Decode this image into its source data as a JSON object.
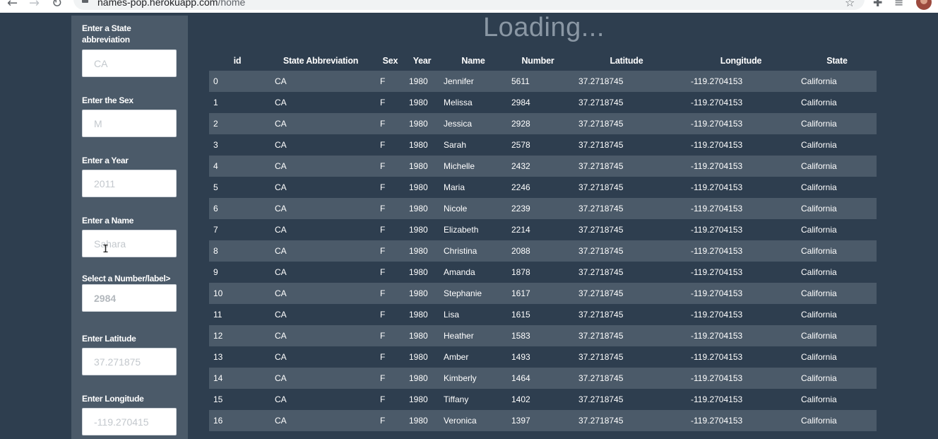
{
  "browser": {
    "url_host": "names-pop.herokuapp.com",
    "url_path": "/home",
    "back_icon": "arrow-left-icon",
    "forward_icon": "arrow-right-icon",
    "reload_icon": "reload-icon"
  },
  "status": {
    "loading_text": "Loading..."
  },
  "form": {
    "state": {
      "label": "Enter a State abbreviation",
      "placeholder": "CA"
    },
    "sex": {
      "label": "Enter the Sex",
      "placeholder": "M"
    },
    "year": {
      "label": "Enter a Year",
      "placeholder": "2011"
    },
    "name": {
      "label": "Enter a Name",
      "placeholder": "Sahara"
    },
    "number": {
      "label": "Select a Number/label>",
      "placeholder": "2984"
    },
    "latitude": {
      "label": "Enter Latitude",
      "placeholder": "37.271875"
    },
    "longitude": {
      "label": "Enter Longitude",
      "placeholder": "-119.270415"
    }
  },
  "table": {
    "columns": [
      "id",
      "State Abbreviation",
      "Sex",
      "Year",
      "Name",
      "Number",
      "Latitude",
      "Longitude",
      "State"
    ],
    "rows": [
      [
        "0",
        "CA",
        "F",
        "1980",
        "Jennifer",
        "5611",
        "37.2718745",
        "-119.2704153",
        "California"
      ],
      [
        "1",
        "CA",
        "F",
        "1980",
        "Melissa",
        "2984",
        "37.2718745",
        "-119.2704153",
        "California"
      ],
      [
        "2",
        "CA",
        "F",
        "1980",
        "Jessica",
        "2928",
        "37.2718745",
        "-119.2704153",
        "California"
      ],
      [
        "3",
        "CA",
        "F",
        "1980",
        "Sarah",
        "2578",
        "37.2718745",
        "-119.2704153",
        "California"
      ],
      [
        "4",
        "CA",
        "F",
        "1980",
        "Michelle",
        "2432",
        "37.2718745",
        "-119.2704153",
        "California"
      ],
      [
        "5",
        "CA",
        "F",
        "1980",
        "Maria",
        "2246",
        "37.2718745",
        "-119.2704153",
        "California"
      ],
      [
        "6",
        "CA",
        "F",
        "1980",
        "Nicole",
        "2239",
        "37.2718745",
        "-119.2704153",
        "California"
      ],
      [
        "7",
        "CA",
        "F",
        "1980",
        "Elizabeth",
        "2214",
        "37.2718745",
        "-119.2704153",
        "California"
      ],
      [
        "8",
        "CA",
        "F",
        "1980",
        "Christina",
        "2088",
        "37.2718745",
        "-119.2704153",
        "California"
      ],
      [
        "9",
        "CA",
        "F",
        "1980",
        "Amanda",
        "1878",
        "37.2718745",
        "-119.2704153",
        "California"
      ],
      [
        "10",
        "CA",
        "F",
        "1980",
        "Stephanie",
        "1617",
        "37.2718745",
        "-119.2704153",
        "California"
      ],
      [
        "11",
        "CA",
        "F",
        "1980",
        "Lisa",
        "1615",
        "37.2718745",
        "-119.2704153",
        "California"
      ],
      [
        "12",
        "CA",
        "F",
        "1980",
        "Heather",
        "1583",
        "37.2718745",
        "-119.2704153",
        "California"
      ],
      [
        "13",
        "CA",
        "F",
        "1980",
        "Amber",
        "1493",
        "37.2718745",
        "-119.2704153",
        "California"
      ],
      [
        "14",
        "CA",
        "F",
        "1980",
        "Kimberly",
        "1464",
        "37.2718745",
        "-119.2704153",
        "California"
      ],
      [
        "15",
        "CA",
        "F",
        "1980",
        "Tiffany",
        "1402",
        "37.2718745",
        "-119.2704153",
        "California"
      ],
      [
        "16",
        "CA",
        "F",
        "1980",
        "Veronica",
        "1397",
        "37.2718745",
        "-119.2704153",
        "California"
      ]
    ]
  },
  "colors": {
    "page_background": "#2e3e4f",
    "sidebar_background": "#4b5a69",
    "striped_row": "#4b5a69",
    "loading_text": "#8a97a4"
  }
}
